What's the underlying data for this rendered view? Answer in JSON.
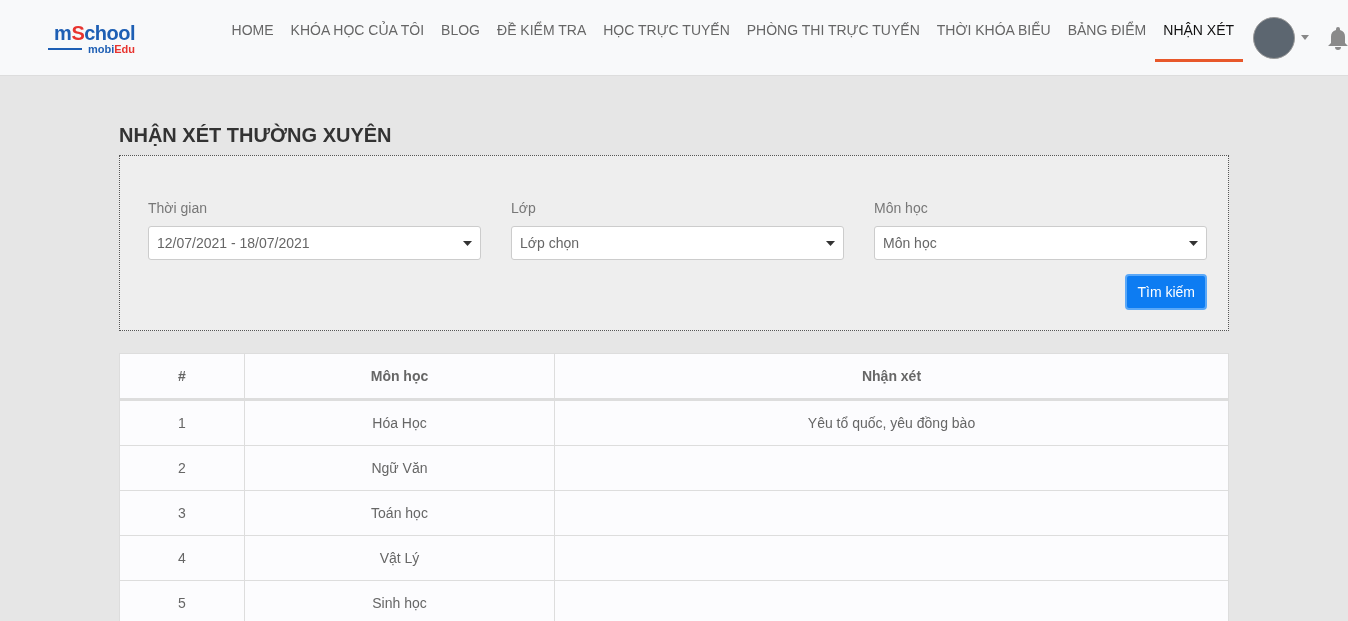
{
  "logo": {
    "title": [
      {
        "text": "m",
        "color": "#1e5fb4"
      },
      {
        "text": "S",
        "color": "#e8342f"
      },
      {
        "text": "chool",
        "color": "#1e5fb4"
      }
    ],
    "subtitle": [
      {
        "text": "mobi",
        "color": "#1e5fb4"
      },
      {
        "text": "Edu",
        "color": "#e8342f"
      }
    ]
  },
  "nav": [
    {
      "label": "HOME",
      "selected": false
    },
    {
      "label": "KHÓA HỌC CỦA TÔI",
      "selected": false
    },
    {
      "label": "BLOG",
      "selected": false
    },
    {
      "label": "ĐỀ KIỂM TRA",
      "selected": false
    },
    {
      "label": "HỌC TRỰC TUYẾN",
      "selected": false
    },
    {
      "label": "PHÒNG THI TRỰC TUYẾN",
      "selected": false
    },
    {
      "label": "THỜI KHÓA BIỂU",
      "selected": false
    },
    {
      "label": "BẢNG ĐIỂM",
      "selected": false
    },
    {
      "label": "NHẬN XÉT",
      "selected": true
    }
  ],
  "page_title": "NHẬN XÉT THƯỜNG XUYÊN",
  "filters": [
    {
      "label": "Thời gian",
      "value": "12/07/2021 - 18/07/2021"
    },
    {
      "label": "Lớp",
      "value": "Lớp chọn"
    },
    {
      "label": "Môn học",
      "value": "Môn học"
    }
  ],
  "search_button": "Tìm kiếm",
  "table": {
    "columns": [
      "#",
      "Môn học",
      "Nhận xét"
    ],
    "rows": [
      [
        "1",
        "Hóa Học",
        "Yêu tổ quốc, yêu đồng bào"
      ],
      [
        "2",
        "Ngữ Văn",
        ""
      ],
      [
        "3",
        "Toán học",
        ""
      ],
      [
        "4",
        "Vật Lý",
        ""
      ],
      [
        "5",
        "Sinh học",
        ""
      ]
    ]
  }
}
